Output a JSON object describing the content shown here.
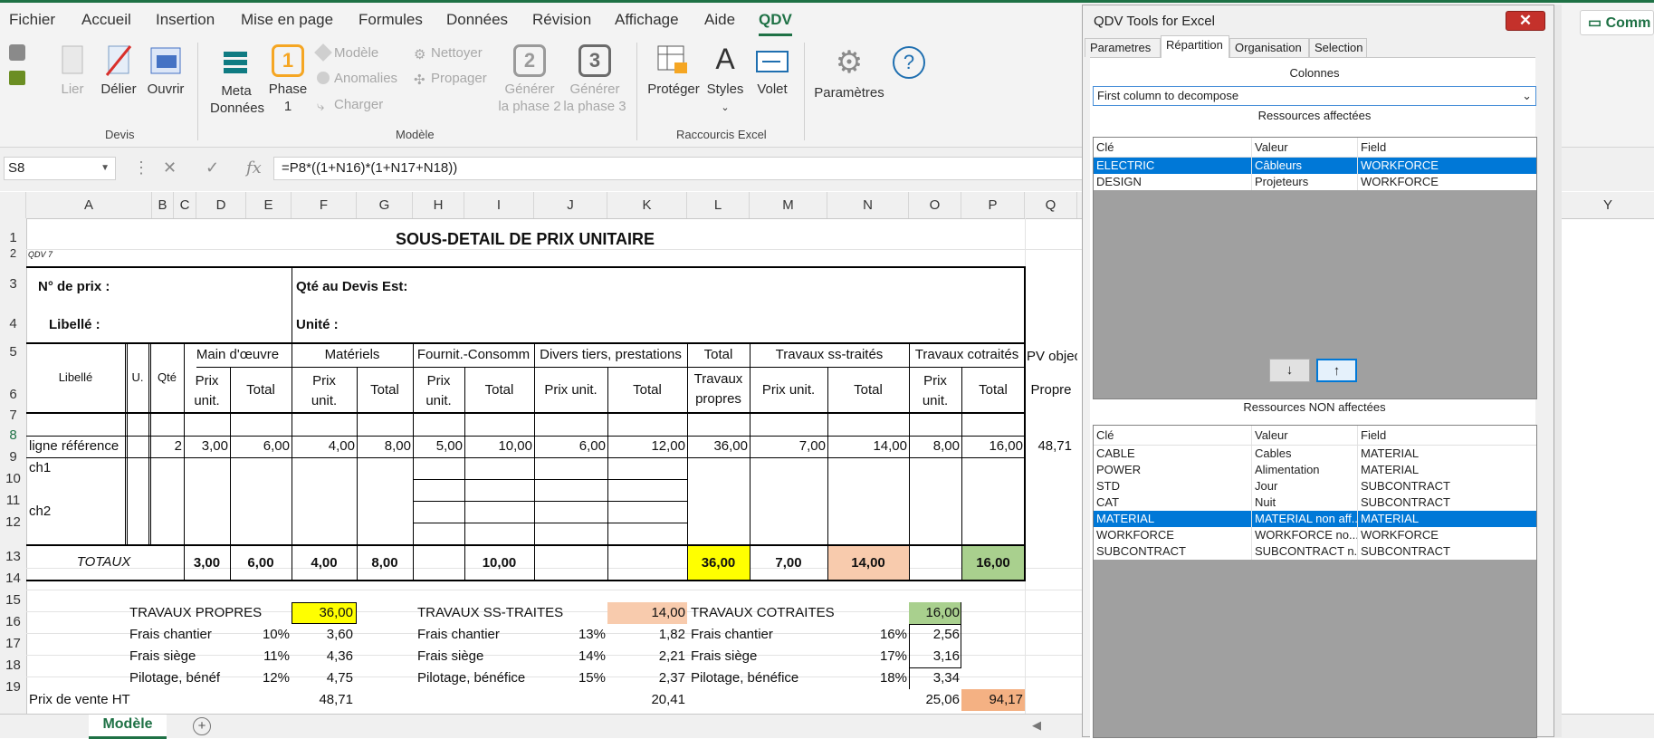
{
  "tabs": [
    "Fichier",
    "Accueil",
    "Insertion",
    "Mise en page",
    "Formules",
    "Données",
    "Révision",
    "Affichage",
    "Aide",
    "QDV"
  ],
  "comm_label": "Comm",
  "ribbon": {
    "lier": "Lier",
    "delier": "Délier",
    "ouvrir": "Ouvrir",
    "group_devis": "Devis",
    "meta1": "Meta",
    "meta2": "Données",
    "phase1_num": "1",
    "phase1_a": "Phase",
    "phase1_b": "1",
    "modele": "Modèle",
    "anomalies": "Anomalies",
    "charger": "Charger",
    "nettoyer": "Nettoyer",
    "propager": "Propager",
    "phase2_num": "2",
    "gen2_a": "Générer",
    "gen2_b": "la phase 2",
    "phase3_num": "3",
    "gen3_a": "Générer",
    "gen3_b": "la phase 3",
    "group_modele": "Modèle",
    "proteger": "Protéger",
    "styles": "Styles",
    "volet": "Volet",
    "group_raccourcis": "Raccourcis Excel",
    "parametres": "Paramètres"
  },
  "formula_bar": {
    "cell_ref": "S8",
    "formula": "=P8*((1+N16)*(1+N17+N18))"
  },
  "col_letters": [
    "A",
    "B",
    "C",
    "D",
    "E",
    "F",
    "G",
    "H",
    "I",
    "J",
    "K",
    "L",
    "M",
    "N",
    "O",
    "P",
    "Q",
    "Y"
  ],
  "row_numbers": [
    "1",
    "2",
    "3",
    "4",
    "5",
    "6",
    "7",
    "8",
    "9",
    "10",
    "11",
    "12",
    "13",
    "14",
    "15",
    "16",
    "17",
    "18",
    "19"
  ],
  "sheet": {
    "title": "SOUS-DETAIL DE PRIX UNITAIRE",
    "qdv7": "QDV 7",
    "no_prix": "N° de prix :",
    "qte_devis": "Qté au Devis Est:",
    "libelle_lbl": "Libellé :",
    "unite_lbl": "Unité :",
    "h_libelle": "Libellé",
    "h_u": "U.",
    "h_qte": "Qté",
    "h_main": "Main d'œuvre",
    "h_materiels": "Matériels",
    "h_fournit": "Fournit.-Consomm",
    "h_divers": "Divers tiers, prestations",
    "h_total": "Total",
    "h_travaux_ss": "Travaux ss-traités",
    "h_travaux_co": "Travaux cotraités",
    "h_pv": "PV objec",
    "h_prix": "Prix",
    "h_unit": "unit.",
    "h_prixunit": "Prix unit.",
    "h_tot": "Total",
    "h_travaux": "Travaux",
    "h_propres": "propres",
    "h_propre": "Propre",
    "row8": [
      "ligne référence",
      "2",
      "3,00",
      "6,00",
      "4,00",
      "8,00",
      "5,00",
      "10,00",
      "6,00",
      "12,00",
      "36,00",
      "7,00",
      "14,00",
      "8,00",
      "16,00",
      "48,71"
    ],
    "ch1": "ch1",
    "ch2": "ch2",
    "totaux_lbl": "TOTAUX",
    "totaux": [
      "3,00",
      "6,00",
      "4,00",
      "8,00",
      "10,00",
      "36,00",
      "7,00",
      "14,00",
      "16,00"
    ],
    "tp_lbl": "TRAVAUX PROPRES",
    "tp_val": "36,00",
    "tss_lbl": "TRAVAUX SS-TRAITES",
    "tss_val": "14,00",
    "tco_lbl": "TRAVAUX COTRAITES",
    "tco_val": "16,00",
    "frais_chantier": "Frais chantier",
    "frais_siege": "Frais siège",
    "pilotage1": "Pilotage, bénéf",
    "pilotage2": "Pilotage, bénéfice",
    "pilotage3": "Pilotage, bénéfice",
    "tp_pct": [
      "10%",
      "11%",
      "12%"
    ],
    "tp_vals": [
      "3,60",
      "4,36",
      "4,75"
    ],
    "tss_pct": [
      "13%",
      "14%",
      "15%"
    ],
    "tss_vals": [
      "1,82",
      "2,21",
      "2,37"
    ],
    "tco_pct": [
      "16%",
      "17%",
      "18%"
    ],
    "tco_vals": [
      "2,56",
      "3,16",
      "3,34"
    ],
    "pv_lbl": "Prix de vente HT",
    "pv_tp": "48,71",
    "pv_tss": "20,41",
    "pv_tco": "25,06",
    "pv_total": "94,17"
  },
  "sheet_tab": "Modèle",
  "colors": {
    "yellow": "#ffff00",
    "peach": "#f8cbad",
    "green": "#a9d08e",
    "orange": "#f4b183",
    "excel_green": "#1e7145",
    "select_blue": "#0078d7"
  },
  "dialog": {
    "title": "QDV Tools for Excel",
    "close": "✕",
    "tabs": [
      "Parametres",
      "Répartition",
      "Organisation",
      "Selection"
    ],
    "colonnes_lbl": "Colonnes",
    "combo_value": "First column to decompose",
    "affected_lbl": "Ressources affectées",
    "non_affected_lbl": "Ressources NON affectées",
    "headers": [
      "Clé",
      "Valeur",
      "Field"
    ],
    "affected": [
      [
        "ELECTRIC",
        "Câbleurs",
        "WORKFORCE"
      ],
      [
        "DESIGN",
        "Projeteurs",
        "WORKFORCE"
      ]
    ],
    "non_affected": [
      [
        "CABLE",
        "Cables",
        "MATERIAL"
      ],
      [
        "POWER",
        "Alimentation",
        "MATERIAL"
      ],
      [
        "STD",
        "Jour",
        "SUBCONTRACT"
      ],
      [
        "CAT",
        "Nuit",
        "SUBCONTRACT"
      ],
      [
        "MATERIAL",
        "MATERIAL non aff...",
        "MATERIAL"
      ],
      [
        "WORKFORCE",
        "WORKFORCE no...",
        "WORKFORCE"
      ],
      [
        "SUBCONTRACT",
        "SUBCONTRACT n...",
        "SUBCONTRACT"
      ]
    ],
    "btn_down": "↓",
    "btn_up": "↑"
  }
}
